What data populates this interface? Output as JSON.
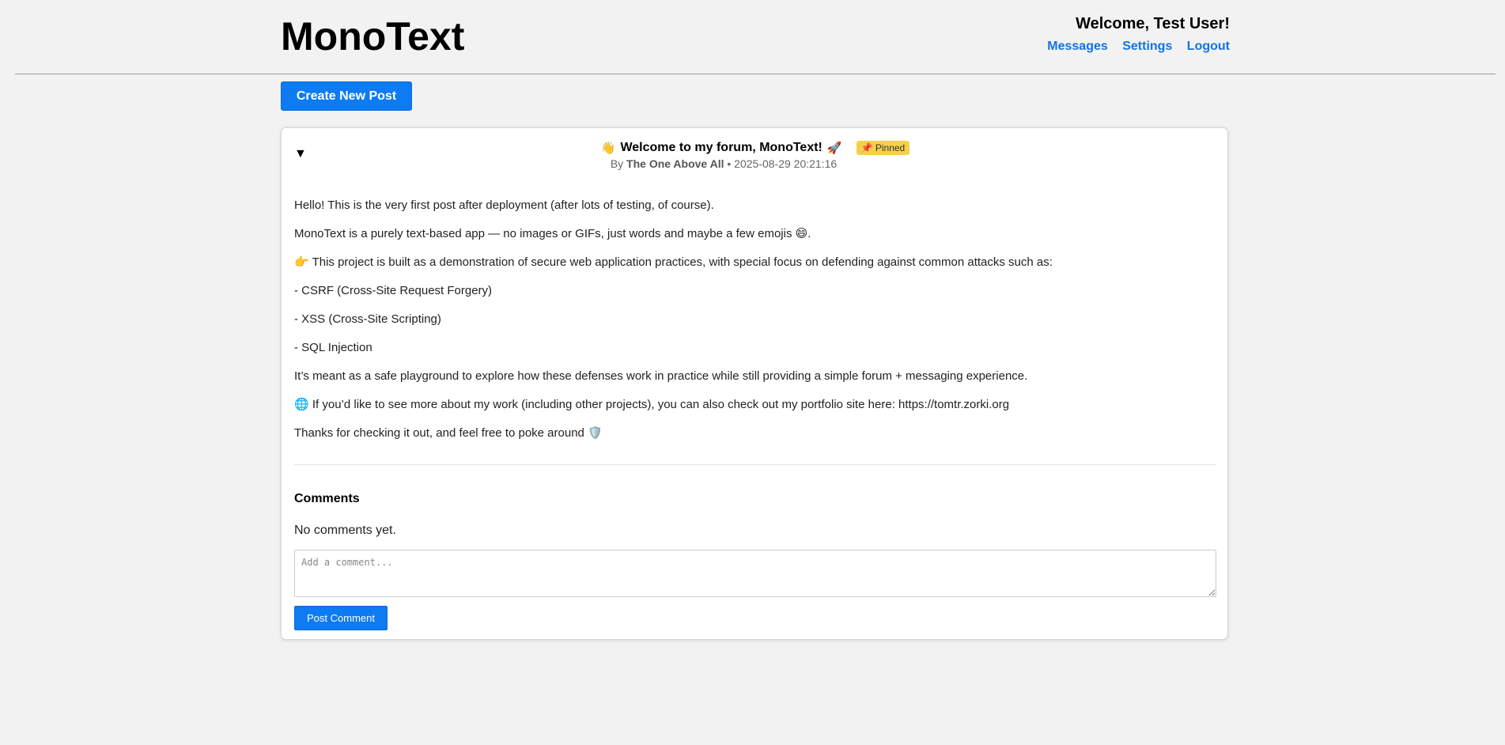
{
  "header": {
    "brand": "MonoText",
    "welcome": "Welcome, Test User!",
    "nav": {
      "messages": "Messages",
      "settings": "Settings",
      "logout": "Logout"
    }
  },
  "toolbar": {
    "create_label": "Create New Post"
  },
  "post": {
    "toggle": "▼",
    "title_emoji_left": "👋",
    "title": "Welcome to my forum, MonoText!",
    "title_emoji_right": "🚀",
    "pinned_icon": "📌",
    "pinned_label": "Pinned",
    "by_label": "By",
    "author": "The One Above All",
    "separator": "•",
    "timestamp": "2025-08-29 20:21:16",
    "body": [
      "Hello! This is the very first post after deployment (after lots of testing, of course).",
      "MonoText is a purely text-based app — no images or GIFs, just words and maybe a few emojis 😄.",
      "👉 This project is built as a demonstration of secure web application practices, with special focus on defending against common attacks such as:",
      "- CSRF (Cross-Site Request Forgery)",
      "- XSS (Cross-Site Scripting)",
      "- SQL Injection",
      "It’s meant as a safe playground to explore how these defenses work in practice while still providing a simple forum + messaging experience.",
      "🌐 If you’d like to see more about my work (including other projects), you can also check out my portfolio site here: https://tomtr.zorki.org",
      "Thanks for checking it out, and feel free to poke around 🛡️"
    ]
  },
  "comments": {
    "title": "Comments",
    "empty": "No comments yet.",
    "placeholder": "Add a comment...",
    "submit_label": "Post Comment"
  },
  "colors": {
    "accent": "#0d7bf2",
    "link": "#1273e6",
    "pinned": "#f7cf4a",
    "background": "#f2f2f2"
  }
}
